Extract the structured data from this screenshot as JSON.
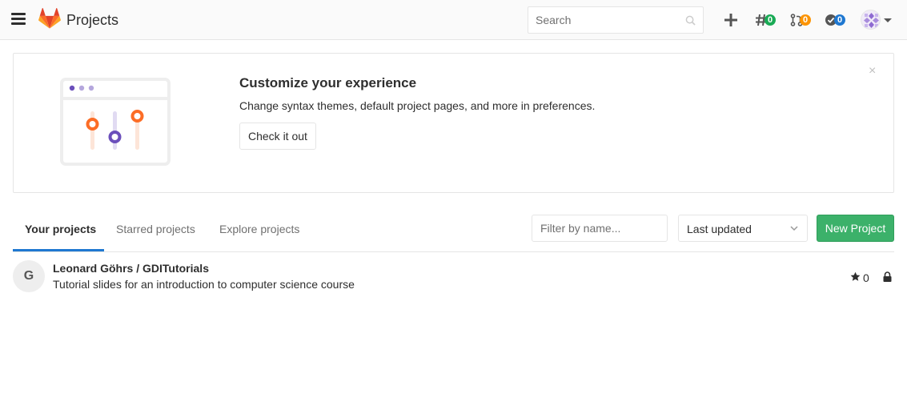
{
  "header": {
    "title": "Projects",
    "search_placeholder": "Search",
    "issues_count": "0",
    "merge_requests_count": "0",
    "todos_count": "0",
    "colors": {
      "issues_badge": "#1aaa55",
      "mr_badge": "#fc9403",
      "todos_badge": "#1f78d1"
    }
  },
  "callout": {
    "title": "Customize your experience",
    "description": "Change syntax themes, default project pages, and more in preferences.",
    "button_label": "Check it out",
    "close_label": "×"
  },
  "tabs": [
    {
      "label": "Your projects",
      "active": true
    },
    {
      "label": "Starred projects",
      "active": false
    },
    {
      "label": "Explore projects",
      "active": false
    }
  ],
  "filter": {
    "placeholder": "Filter by name..."
  },
  "sort": {
    "selected": "Last updated"
  },
  "new_project_label": "New Project",
  "projects": [
    {
      "avatar_letter": "G",
      "name": "Leonard Göhrs / GDITutorials",
      "description": "Tutorial slides for an introduction to computer science course",
      "stars": "0",
      "visibility_icon": "lock-icon"
    }
  ],
  "colors": {
    "accent": "#1f78d1",
    "success": "#3cb16a",
    "brand_orange": "#fc6d26"
  }
}
